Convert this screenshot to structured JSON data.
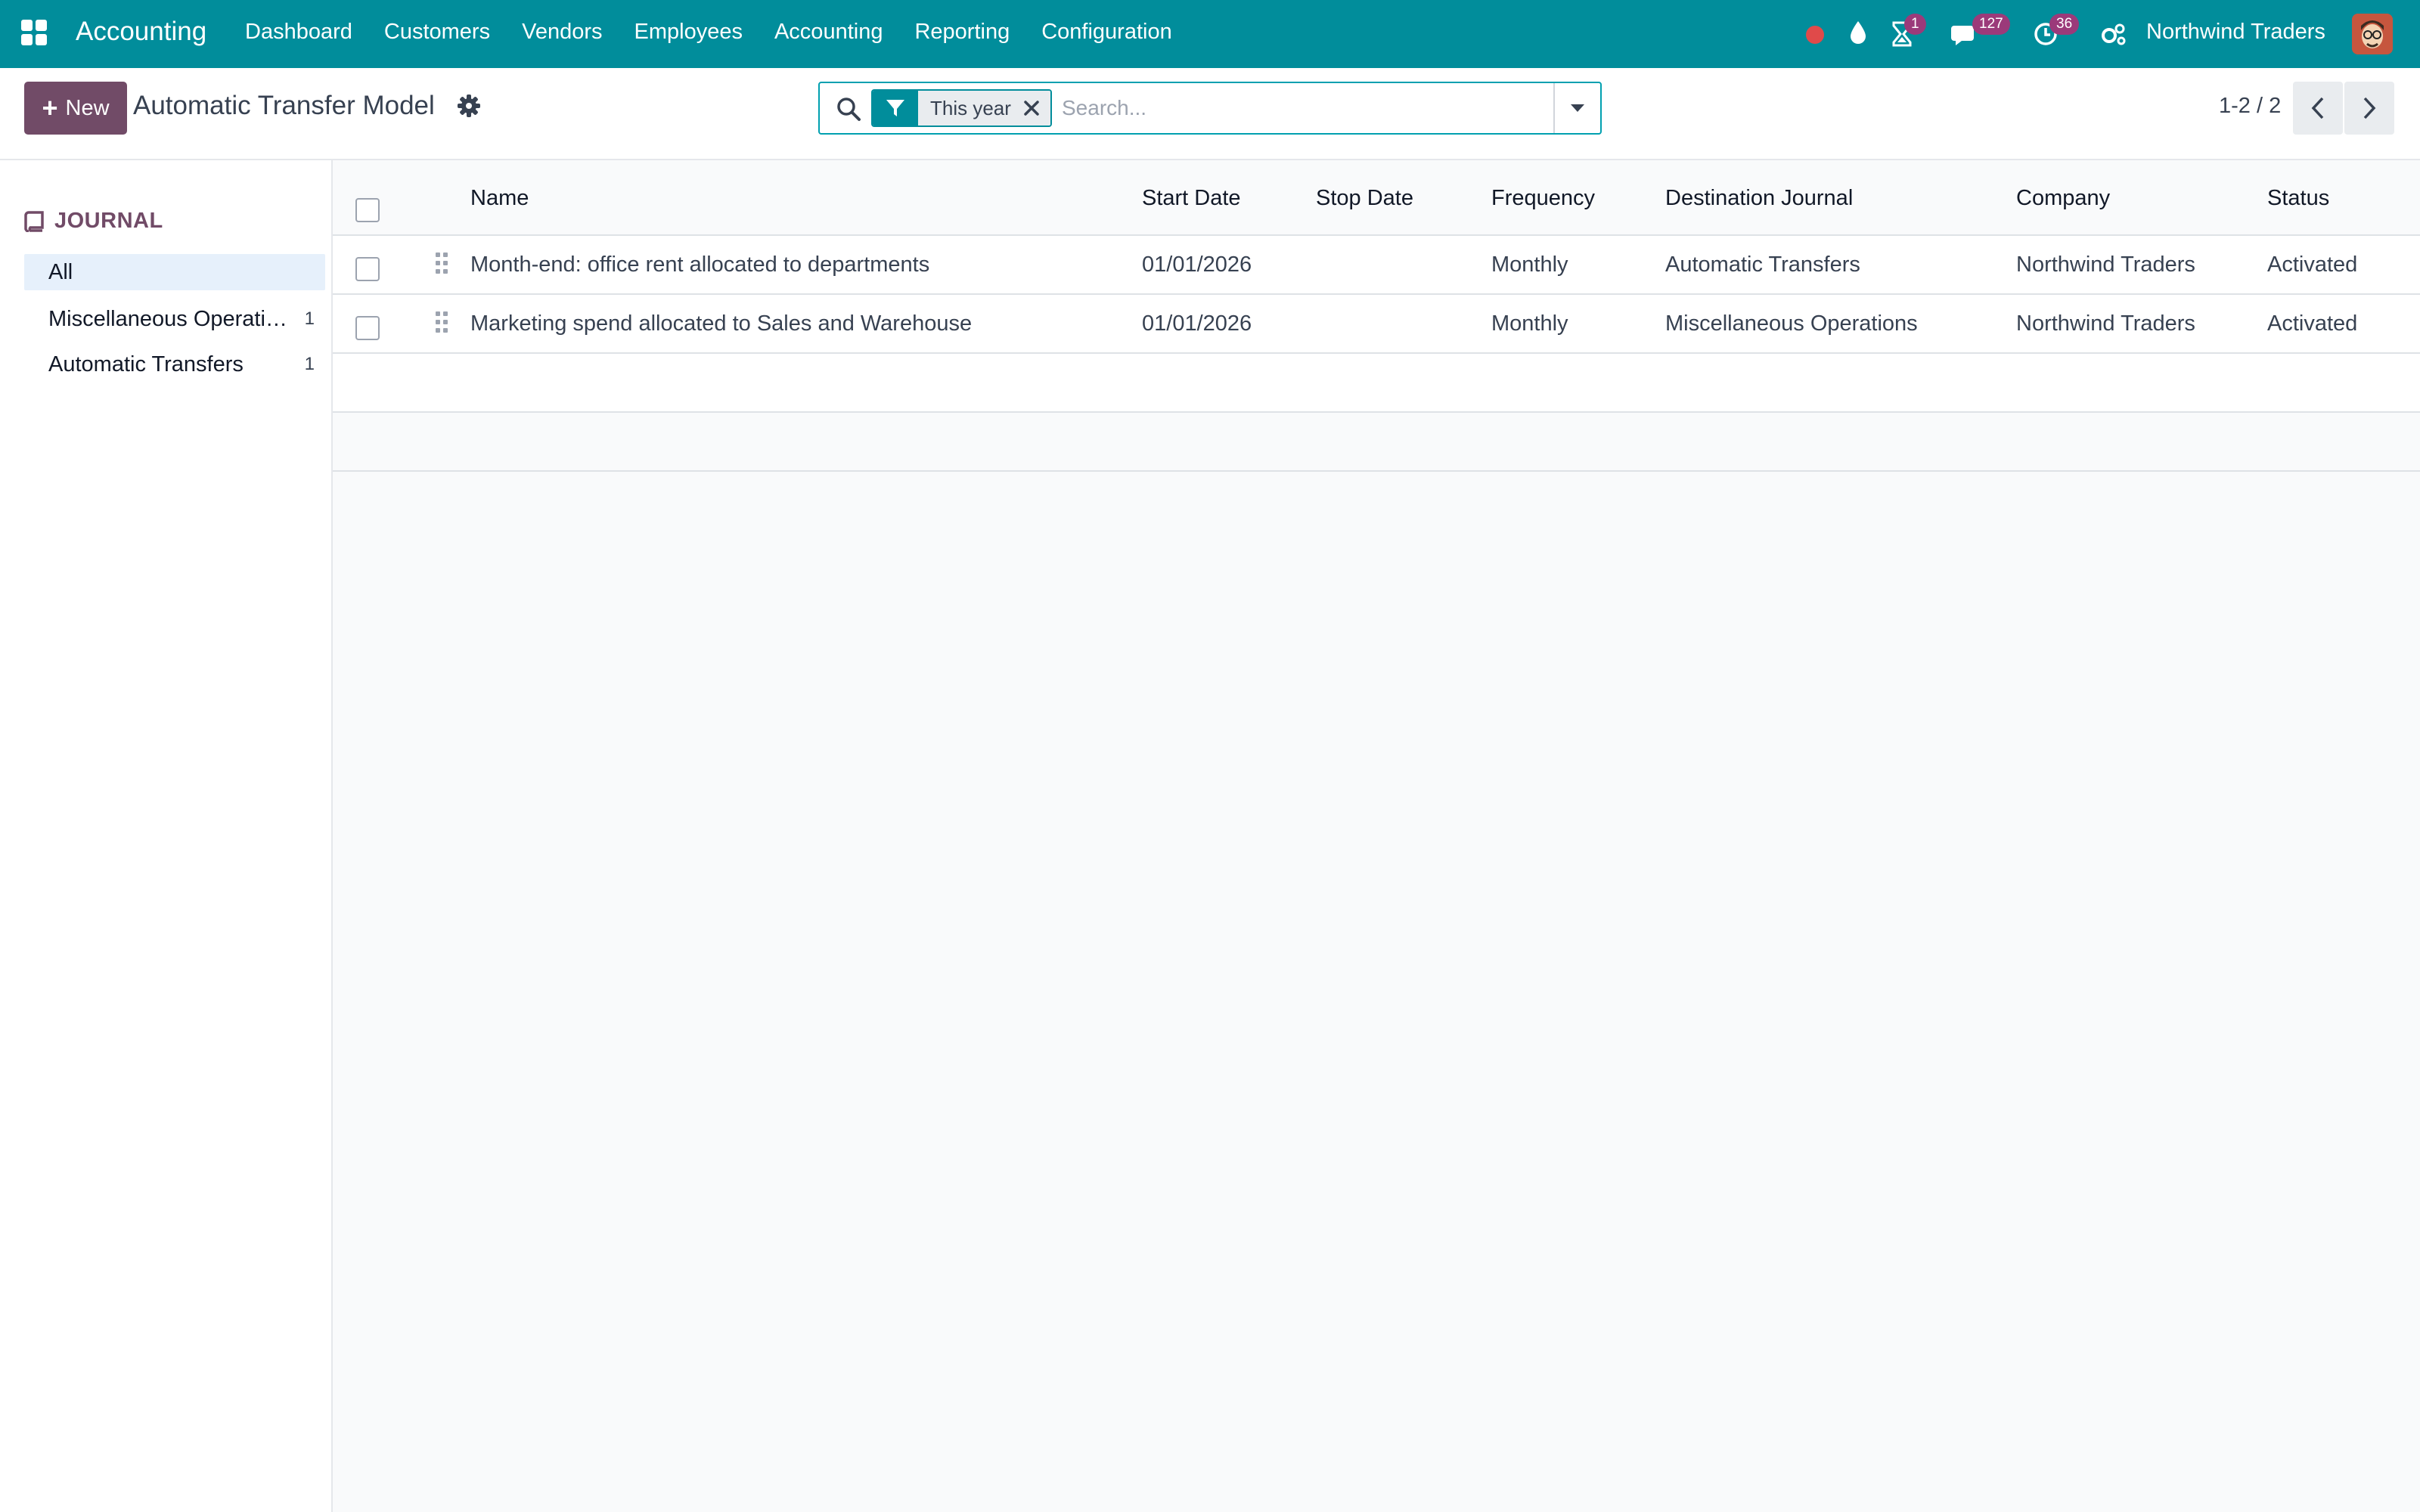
{
  "navbar": {
    "app_name": "Accounting",
    "menu": [
      "Dashboard",
      "Customers",
      "Vendors",
      "Employees",
      "Accounting",
      "Reporting",
      "Configuration"
    ],
    "activity_count": "1",
    "messages_count": "127",
    "clock_count": "36",
    "company": "Northwind Traders"
  },
  "control": {
    "new_label": "New",
    "title": "Automatic Transfer Model",
    "search": {
      "facet_label": "This year",
      "placeholder": "Search..."
    },
    "pager": "1-2 / 2"
  },
  "sidebar": {
    "header": "JOURNAL",
    "items": [
      {
        "label": "All",
        "count": ""
      },
      {
        "label": "Miscellaneous Operations",
        "count": "1"
      },
      {
        "label": "Automatic Transfers",
        "count": "1"
      }
    ]
  },
  "table": {
    "columns": [
      "Name",
      "Start Date",
      "Stop Date",
      "Frequency",
      "Destination Journal",
      "Company",
      "Status"
    ],
    "rows": [
      {
        "name": "Month-end: office rent allocated to departments",
        "start_date": "01/01/2026",
        "stop_date": "",
        "frequency": "Monthly",
        "journal": "Automatic Transfers",
        "company": "Northwind Traders",
        "status": "Activated"
      },
      {
        "name": "Marketing spend allocated to Sales and Warehouse",
        "start_date": "01/01/2026",
        "stop_date": "",
        "frequency": "Monthly",
        "journal": "Miscellaneous Operations",
        "company": "Northwind Traders",
        "status": "Activated"
      }
    ]
  },
  "colors": {
    "navbar": "#018d9b",
    "primary": "#714b67",
    "badge": "#9b3a7a",
    "record_dot": "#e04a4a"
  }
}
